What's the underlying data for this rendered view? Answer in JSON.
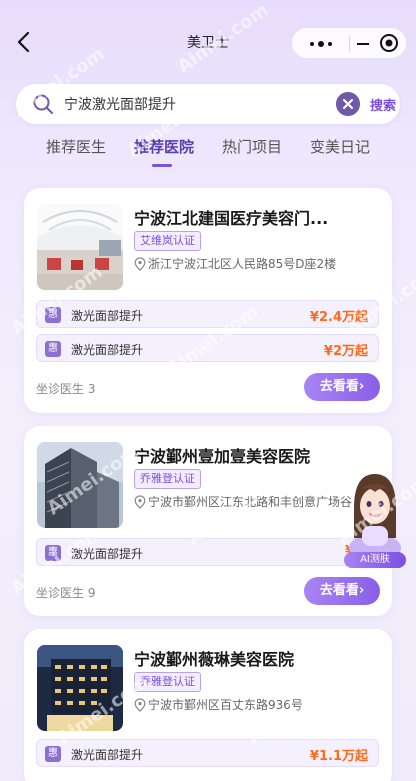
{
  "nav": {
    "title": "美卫士"
  },
  "search": {
    "query": "宁波激光面部提升",
    "placeholder": "",
    "button_label": "搜索"
  },
  "tabs": [
    {
      "label": "推荐医生"
    },
    {
      "label": "推荐医院"
    },
    {
      "label": "热门项目"
    },
    {
      "label": "变美日记"
    }
  ],
  "hospitals": [
    {
      "name": "宁波江北建国医疗美容门...",
      "certification": "艾维岚认证",
      "address": "浙江宁波江北区人民路85号D座2楼",
      "projects": [
        {
          "icon_text": "惠",
          "name": "激光面部提升",
          "price": "¥2.4万起"
        },
        {
          "icon_text": "惠",
          "name": "激光面部提升",
          "price": "¥2万起"
        }
      ],
      "doctor_count": "坐诊医生 3",
      "button_label": "去看看›"
    },
    {
      "name": "宁波鄞州壹加壹美容医院",
      "certification": "乔雅登认证",
      "address": "宁波市鄞州区江东北路和丰创意广场谷",
      "projects": [
        {
          "icon_text": "惠",
          "name": "激光面部提升",
          "price": "¥2."
        }
      ],
      "doctor_count": "坐诊医生 9",
      "button_label": "去看看›"
    },
    {
      "name": "宁波鄞州薇琳美容医院",
      "certification": "乔雅登认证",
      "address": "宁波市鄞州区百丈东路936号",
      "projects": [
        {
          "icon_text": "惠",
          "name": "激光面部提升",
          "price": "¥1.1万起"
        }
      ]
    }
  ],
  "ai_assistant": {
    "label": "AI测肤"
  },
  "watermark": {
    "text": "Aimei.com"
  },
  "colors": {
    "accent": "#7b4fe0",
    "price": "#ff6a1a",
    "background": "#efe9fd"
  }
}
